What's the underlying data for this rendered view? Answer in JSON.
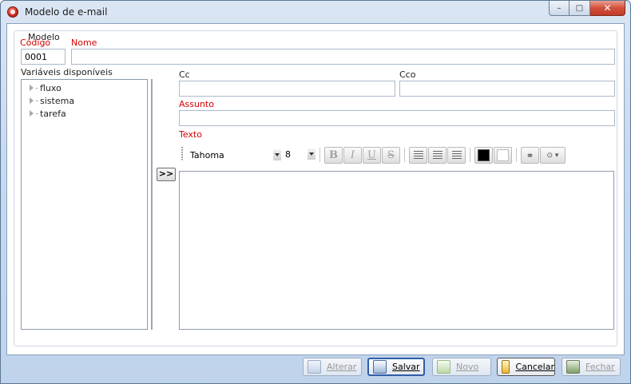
{
  "window": {
    "title": "Modelo de e-mail",
    "controls": {
      "minimize": "–",
      "maximize": "□",
      "close": "✕"
    }
  },
  "group": {
    "title": "Modelo"
  },
  "form": {
    "codigo_label": "Código",
    "codigo_value": "0001",
    "nome_label": "Nome",
    "nome_value": "",
    "variaveis_label": "Variáveis disponíveis",
    "cc_label": "Cc",
    "cc_value": "",
    "cco_label": "Cco",
    "cco_value": "",
    "assunto_label": "Assunto",
    "assunto_value": "",
    "texto_label": "Texto",
    "texto_value": "",
    "add_variable_label": ">>"
  },
  "tree": {
    "items": [
      {
        "label": "fluxo"
      },
      {
        "label": "sistema"
      },
      {
        "label": "tarefa"
      }
    ]
  },
  "toolbar": {
    "font": "Tahoma",
    "size": "8",
    "bold": "B",
    "italic": "I",
    "underline": "U",
    "strike": "S",
    "link_glyph": "⚭",
    "more_glyph": "⊙ ▾",
    "text_color": "#000000",
    "background_color": "#ffffff"
  },
  "actions": {
    "alterar": "Alterar",
    "salvar": "Salvar",
    "novo": "Novo",
    "cancelar": "Cancelar",
    "fechar": "Fechar"
  },
  "colors": {
    "required_label": "#d40000",
    "focus_border": "#2f5ea8"
  }
}
